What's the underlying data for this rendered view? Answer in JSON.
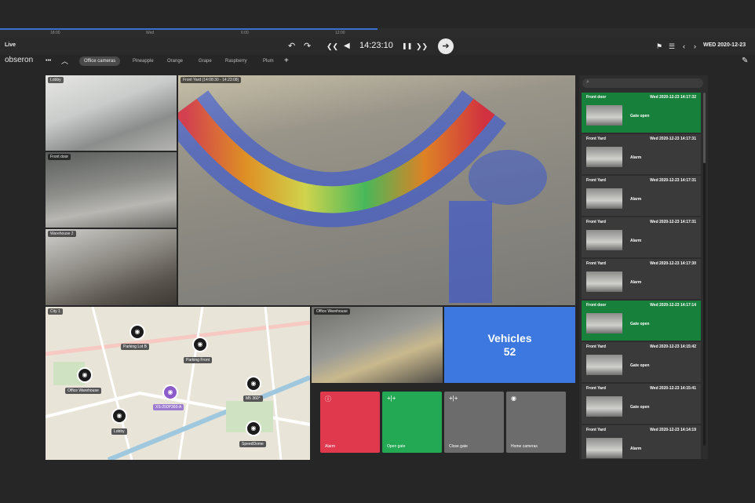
{
  "timeline": {
    "ticks": [
      "18:00",
      "Wed",
      "6:00",
      "12:00"
    ],
    "progress": 0.5
  },
  "controls": {
    "live_label": "Live",
    "undo_icon": "↶",
    "redo_icon": "↷",
    "skip_back_icon": "❮❮",
    "step_back_icon": "◀",
    "time": "14:23:10",
    "pause_icon": "❚❚",
    "skip_forward_icon": "❯❯",
    "go_live_icon": "➔",
    "date": "WED 2020-12-23"
  },
  "tabs": {
    "brand": "obseron",
    "more_icon": "•••",
    "collapse_icon": "︿",
    "items": [
      {
        "label": "Office cameras",
        "active": true
      },
      {
        "label": "Pineapple"
      },
      {
        "label": "Orange"
      },
      {
        "label": "Grape"
      },
      {
        "label": "Raspberry"
      },
      {
        "label": "Plum"
      }
    ],
    "add_icon": "+",
    "edit_icon": "✎"
  },
  "cameras": {
    "lobby": "Lobby",
    "front_door": "Front door",
    "warehouse": "Warehouse 2",
    "front_yard": "Front Yard (14:08:30 - 14:23:08)",
    "office_warehouse": "Office Warehouse"
  },
  "map": {
    "title": "City 1",
    "pins": [
      {
        "label": "Parking Lot B"
      },
      {
        "label": "Parking Front"
      },
      {
        "label": "Office Warehouse"
      },
      {
        "label": "XS-250P360-A",
        "purple": true
      },
      {
        "label": "M5 360°"
      },
      {
        "label": "Lobby"
      },
      {
        "label": "SpeedDome"
      }
    ]
  },
  "vehicles": {
    "title": "Vehicles",
    "count": "52"
  },
  "actions": [
    {
      "label": "Alarm",
      "icon": "ⓘ",
      "color": "#e0384d"
    },
    {
      "label": "Open gate",
      "icon": "+|+",
      "color": "#23a954"
    },
    {
      "label": "Close gate",
      "icon": "+|+",
      "color": "#6c6c6c"
    },
    {
      "label": "Home cameras",
      "icon": "◉",
      "color": "#6c6c6c"
    }
  ],
  "events": [
    {
      "camera": "Front door",
      "time": "Wed 2020-12-23 14:17:32",
      "type": "Gate open",
      "green": true
    },
    {
      "camera": "Front Yard",
      "time": "Wed 2020-12-23 14:17:31",
      "type": "Alarm"
    },
    {
      "camera": "Front Yard",
      "time": "Wed 2020-12-23 14:17:31",
      "type": "Alarm"
    },
    {
      "camera": "Front Yard",
      "time": "Wed 2020-12-23 14:17:31",
      "type": "Alarm"
    },
    {
      "camera": "Front Yard",
      "time": "Wed 2020-12-23 14:17:30",
      "type": "Alarm"
    },
    {
      "camera": "Front door",
      "time": "Wed 2020-12-23 14:17:14",
      "type": "Gate open",
      "green": true
    },
    {
      "camera": "Front Yard",
      "time": "Wed 2020-12-23 14:15:42",
      "type": "Gate open"
    },
    {
      "camera": "Front Yard",
      "time": "Wed 2020-12-23 14:15:41",
      "type": "Gate open"
    },
    {
      "camera": "Front Yard",
      "time": "Wed 2020-12-23 14:14:19",
      "type": "Alarm"
    }
  ]
}
